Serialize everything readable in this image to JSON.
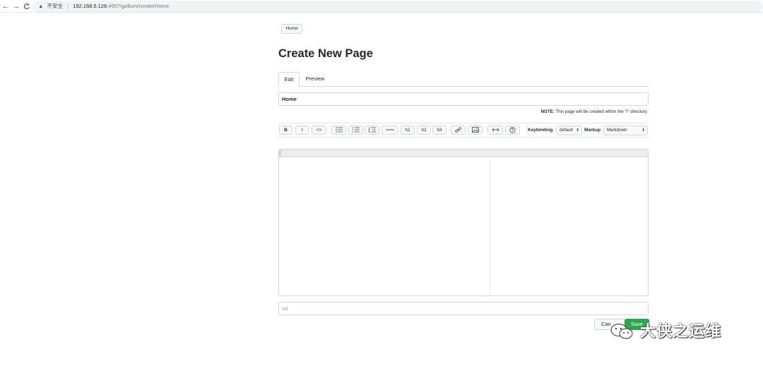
{
  "browser": {
    "back": "←",
    "forward": "→",
    "reload": "C",
    "security_label": "不安全",
    "host": "192.168.5.128",
    "path": ":4567/gollum/create/Home"
  },
  "breadcrumb": {
    "home": "Home"
  },
  "page_title": "Create New Page",
  "tabs": [
    {
      "label": "Edit",
      "active": true
    },
    {
      "label": "Preview",
      "active": false
    }
  ],
  "page_name_value": "Home",
  "note": {
    "prefix": "NOTE:",
    "text": " This page will be created within the \"/\" directory"
  },
  "toolbar": {
    "bold": "B",
    "italic": "I",
    "code": "<>",
    "h1": "h1",
    "h2": "h2",
    "h3": "h3",
    "keybinding_label": "Keybinding",
    "keybinding_value": "default",
    "markup_label": "Markup",
    "markup_value": "Markdown"
  },
  "commit_message_value": "sd",
  "buttons": {
    "cancel": "Can",
    "save": "Save"
  },
  "watermark": "大侠之运维",
  "colors": {
    "save": "#2da44e",
    "border": "#d0d7de"
  }
}
